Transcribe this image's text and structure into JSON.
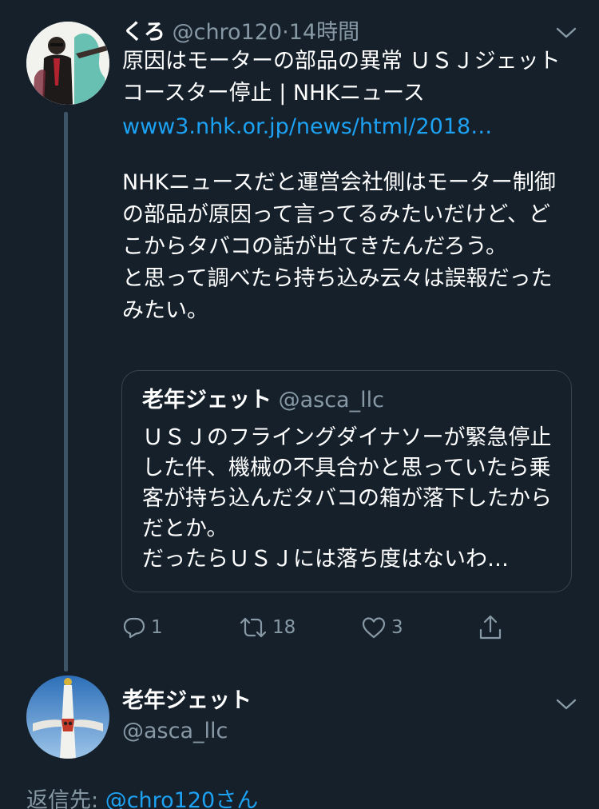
{
  "tweet": {
    "author_name": "くろ",
    "author_handle": "@chro120",
    "separator": "·",
    "time": "14時間",
    "headline": "原因はモーターの部品の異常 ＵＳＪジェットコースター停止 | NHKニュース",
    "link": "www3.nhk.or.jp/news/html/2018…",
    "body": "NHKニュースだと運営会社側はモーター制御の部品が原因って言ってるみたいだけど、どこからタバコの話が出てきたんだろう。\nと思って調べたら持ち込み云々は誤報だったみたい。"
  },
  "quoted": {
    "author_name": "老年ジェット",
    "author_handle": "@asca_llc",
    "text": "ＵＳＪのフライングダイナソーが緊急停止した件、機械の不具合かと思っていたら乗客が持ち込んだタバコの箱が落下したからだとか。\nだったらＵＳＪには落ち度はないわ…"
  },
  "actions": {
    "reply_count": "1",
    "retweet_count": "18",
    "like_count": "3"
  },
  "reply": {
    "author_name": "老年ジェット",
    "author_handle": "@asca_llc",
    "reply_to_label": "返信先: ",
    "reply_to_target": "@chro120さん"
  },
  "icons": [
    "chevron-down-icon",
    "reply-icon",
    "retweet-icon",
    "like-icon",
    "share-icon"
  ],
  "colors": {
    "background": "#15202b",
    "link": "#1da1f2",
    "secondary_text": "#8899a6",
    "border": "#38444d"
  }
}
